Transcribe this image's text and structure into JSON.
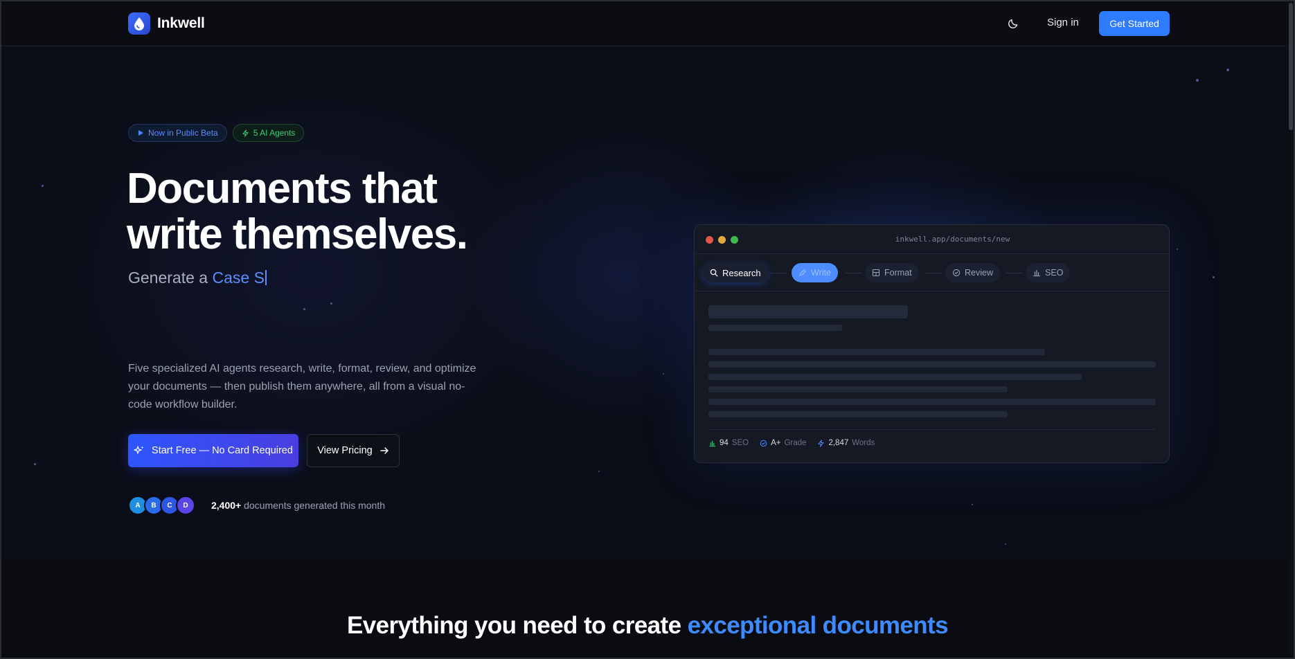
{
  "nav": {
    "brand": "Inkwell",
    "signin_label": "Sign in",
    "cta_label": "Get Started"
  },
  "hero": {
    "badges": {
      "beta": "Now in Public Beta",
      "agents": "5 AI Agents"
    },
    "headline_line1": "Documents that",
    "headline_line2": "write themselves.",
    "generate_prefix": "Generate a",
    "generate_typed": "Case S",
    "description": "Five specialized AI agents research, write, format, review, and optimize your documents — then publish them anywhere, all from a visual no-code workflow builder.",
    "primary_cta": "Start Free — No Card Required",
    "secondary_cta": "View Pricing",
    "avatars": [
      "A",
      "B",
      "C",
      "D"
    ],
    "social_count": "2,400+",
    "social_text": "documents generated this month"
  },
  "mock": {
    "url": "inkwell.app/documents/new",
    "steps": [
      "Research",
      "Write",
      "Format",
      "Review",
      "SEO"
    ],
    "stats": [
      {
        "value": "94",
        "label": "SEO"
      },
      {
        "value": "A+",
        "label": "Grade"
      },
      {
        "value": "2,847",
        "label": "Words"
      }
    ]
  },
  "features": {
    "title_prefix": "Everything you need to create",
    "title_accent": "exceptional documents"
  },
  "colors": {
    "accent": "#2f7bff",
    "beta_badge": "#5b8dff",
    "agents_badge": "#3ecf7d",
    "traffic_red": "#e5534b",
    "traffic_yellow": "#e2a93b",
    "traffic_green": "#3fb950"
  }
}
